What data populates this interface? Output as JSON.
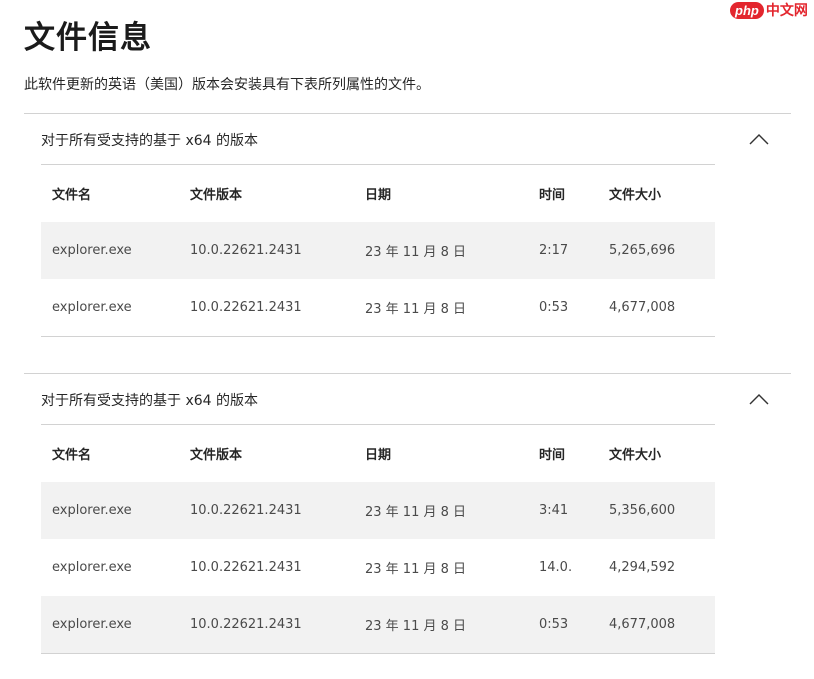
{
  "watermark": {
    "badge": "php",
    "site": "中文网"
  },
  "page": {
    "title": "文件信息",
    "intro": "此软件更新的英语（美国）版本会安装具有下表所列属性的文件。"
  },
  "sections": [
    {
      "title": "对于所有受支持的基于 x64 的版本",
      "expanded": true,
      "columns": [
        "文件名",
        "文件版本",
        "日期",
        "时间",
        "文件大小"
      ],
      "rows": [
        [
          "explorer.exe",
          "10.0.22621.2431",
          "23 年 11 月 8 日",
          "2:17",
          "5,265,696"
        ],
        [
          "explorer.exe",
          "10.0.22621.2431",
          "23 年 11 月 8 日",
          "0:53",
          "4,677,008"
        ]
      ]
    },
    {
      "title": "对于所有受支持的基于 x64 的版本",
      "expanded": true,
      "columns": [
        "文件名",
        "文件版本",
        "日期",
        "时间",
        "文件大小"
      ],
      "rows": [
        [
          "explorer.exe",
          "10.0.22621.2431",
          "23 年 11 月 8 日",
          "3:41",
          "5,356,600"
        ],
        [
          "explorer.exe",
          "10.0.22621.2431",
          "23 年 11 月 8 日",
          "14.0.",
          "4,294,592"
        ],
        [
          "explorer.exe",
          "10.0.22621.2431",
          "23 年 11 月 8 日",
          "0:53",
          "4,677,008"
        ]
      ]
    }
  ]
}
